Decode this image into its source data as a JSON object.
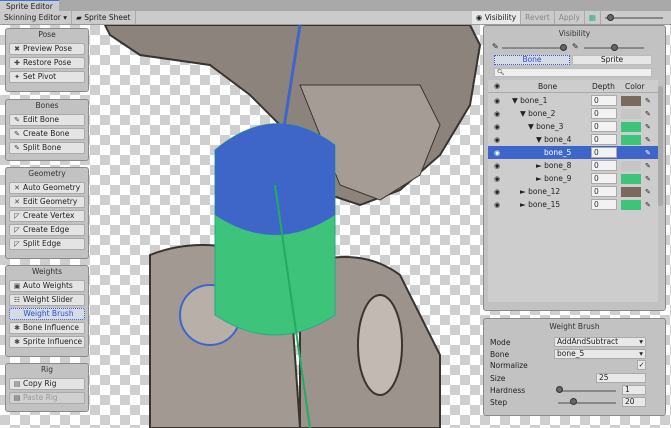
{
  "window": {
    "title": "Sprite Editor"
  },
  "toolbar": {
    "mode": "Skinning Editor ▾",
    "sprite_sheet": "Sprite Sheet",
    "visibility": "Visibility",
    "revert": "Revert",
    "apply": "Apply"
  },
  "left_panels": {
    "pose": {
      "title": "Pose",
      "items": [
        {
          "label": "Preview Pose",
          "icon": "pose-icon"
        },
        {
          "label": "Restore Pose",
          "icon": "restore-icon"
        },
        {
          "label": "Set Pivot",
          "icon": "pivot-icon"
        }
      ]
    },
    "bones": {
      "title": "Bones",
      "items": [
        {
          "label": "Edit Bone",
          "icon": "bone-icon"
        },
        {
          "label": "Create Bone",
          "icon": "bone-icon"
        },
        {
          "label": "Split Bone",
          "icon": "bone-icon"
        }
      ]
    },
    "geometry": {
      "title": "Geometry",
      "items": [
        {
          "label": "Auto Geometry"
        },
        {
          "label": "Edit Geometry"
        },
        {
          "label": "Create Vertex"
        },
        {
          "label": "Create Edge"
        },
        {
          "label": "Split Edge"
        }
      ]
    },
    "weights": {
      "title": "Weights",
      "items": [
        {
          "label": "Auto Weights"
        },
        {
          "label": "Weight Slider"
        },
        {
          "label": "Weight Brush",
          "selected": true
        },
        {
          "label": "Bone Influence"
        },
        {
          "label": "Sprite Influence"
        }
      ]
    },
    "rig": {
      "title": "Rig",
      "items": [
        {
          "label": "Copy Rig"
        },
        {
          "label": "Paste Rig",
          "disabled": true
        }
      ]
    }
  },
  "visibility": {
    "title": "Visibility",
    "tabs": [
      "Bone",
      "Sprite"
    ],
    "active_tab": "Bone",
    "search_placeholder": "",
    "columns": {
      "bone": "Bone",
      "depth": "Depth",
      "color": "Color"
    },
    "bones": [
      {
        "name": "▼ bone_1",
        "indent": 0,
        "depth": "0",
        "color": "#7a6a5e"
      },
      {
        "name": "▼ bone_2",
        "indent": 1,
        "depth": "0",
        "color": "#c6c6c6"
      },
      {
        "name": "▼ bone_3",
        "indent": 2,
        "depth": "0",
        "color": "#3ec47a"
      },
      {
        "name": "▼ bone_4",
        "indent": 3,
        "depth": "0",
        "color": "#3ec47a"
      },
      {
        "name": "bone_5",
        "indent": 4,
        "depth": "0",
        "color": "#3e66c8",
        "selected": true
      },
      {
        "name": "► bone_8",
        "indent": 3,
        "depth": "0",
        "color": "#c6c6c6"
      },
      {
        "name": "► bone_9",
        "indent": 3,
        "depth": "0",
        "color": "#3ec47a"
      },
      {
        "name": "► bone_12",
        "indent": 1,
        "depth": "0",
        "color": "#7a6a5e"
      },
      {
        "name": "► bone_15",
        "indent": 1,
        "depth": "0",
        "color": "#3ec47a"
      }
    ]
  },
  "weight_brush": {
    "title": "Weight Brush",
    "mode_label": "Mode",
    "mode_value": "AddAndSubtract",
    "bone_label": "Bone",
    "bone_value": "bone_5",
    "normalize_label": "Normalize",
    "normalize": true,
    "size_label": "Size",
    "size_value": "25",
    "hardness_label": "Hardness",
    "hardness_value": "1",
    "step_label": "Step",
    "step_value": "20"
  }
}
